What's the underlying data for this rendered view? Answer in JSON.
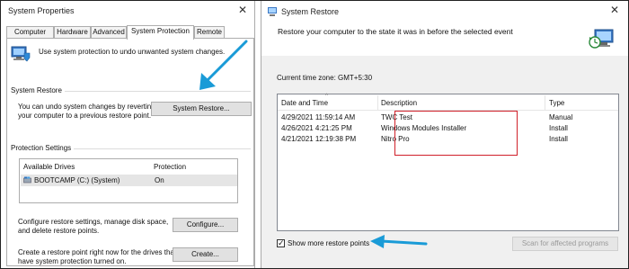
{
  "system_properties": {
    "title": "System Properties",
    "close_glyph": "✕",
    "tabs": [
      {
        "label": "Computer Name",
        "active": false
      },
      {
        "label": "Hardware",
        "active": false
      },
      {
        "label": "Advanced",
        "active": false
      },
      {
        "label": "System Protection",
        "active": true
      },
      {
        "label": "Remote",
        "active": false
      }
    ],
    "intro_text": "Use system protection to undo unwanted system changes.",
    "system_restore": {
      "group_label": "System Restore",
      "description_line1": "You can undo system changes by reverting",
      "description_line2": "your computer to a previous restore point.",
      "button_label": "System Restore..."
    },
    "protection_settings": {
      "group_label": "Protection Settings",
      "columns": [
        "Available Drives",
        "Protection"
      ],
      "drives": [
        {
          "name": "BOOTCAMP (C:) (System)",
          "protection": "On",
          "icon": "hard-drive-icon"
        }
      ],
      "configure_line1": "Configure restore settings, manage disk space,",
      "configure_line2": "and delete restore points.",
      "configure_button": "Configure...",
      "create_line1": "Create a restore point right now for the drives that",
      "create_line2": "have system protection turned on.",
      "create_button": "Create..."
    }
  },
  "system_restore_window": {
    "title": "System Restore",
    "close_glyph": "✕",
    "heading": "Restore your computer to the state it was in before the selected event",
    "timezone": "Current time zone: GMT+5:30",
    "columns": [
      "Date and Time",
      "Description",
      "Type"
    ],
    "rows": [
      {
        "date": "4/29/2021 11:59:14 AM",
        "description": "TWC Test",
        "type": "Manual"
      },
      {
        "date": "4/26/2021 4:21:25 PM",
        "description": "Windows Modules Installer",
        "type": "Install"
      },
      {
        "date": "4/21/2021 12:19:38 PM",
        "description": "Nitro Pro",
        "type": "Install"
      }
    ],
    "show_more_label": "Show more restore points",
    "show_more_checked": true,
    "scan_button": "Scan for affected programs",
    "highlight_color": "#d0202a"
  },
  "annotation_color": "#1a9bd7"
}
